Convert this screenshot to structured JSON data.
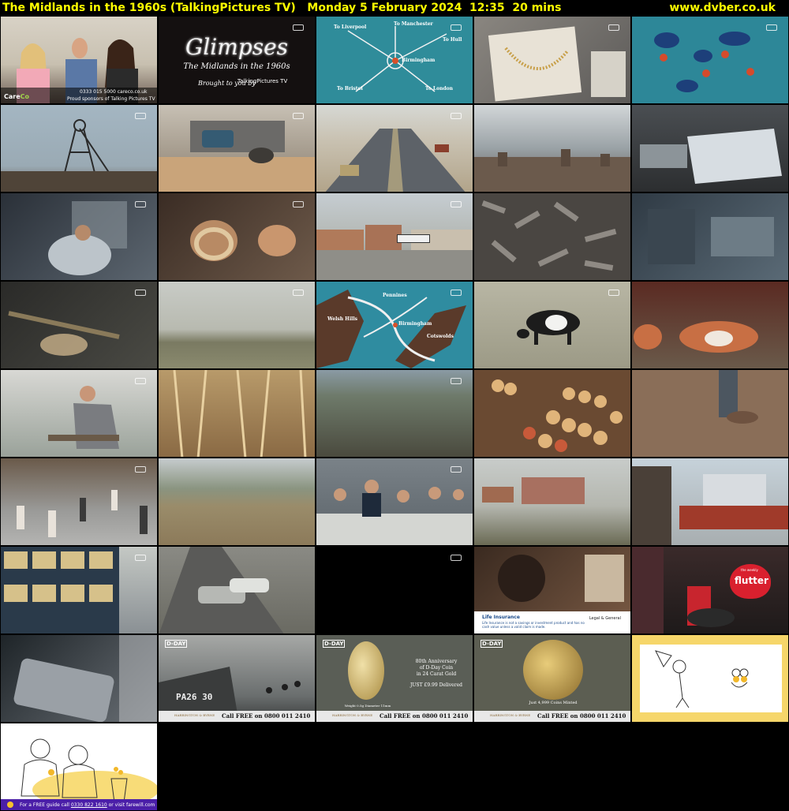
{
  "header": {
    "title": "The Midlands in the 1960s (TalkingPictures TV)   Monday 5 February 2024  12:35  20 mins",
    "site": "www.dvber.co.uk"
  },
  "colors": {
    "header_text": "#ffff00",
    "background": "#000000"
  },
  "tiles": [
    {
      "id": "t01",
      "desc": "careco-advert-couple",
      "texts": {
        "brand_a": "Care",
        "brand_b": "Co",
        "tel": "0333 015 5000   careco.co.uk",
        "sponsor": "Proud sponsors of Talking Pictures TV"
      }
    },
    {
      "id": "t02",
      "desc": "glimpses-title-card",
      "texts": {
        "title": "Glimpses",
        "subtitle": "The Midlands in the 1960s",
        "by": "Brought to you by",
        "channel": "TalkingPictures TV"
      }
    },
    {
      "id": "t03",
      "desc": "road-map-birmingham",
      "texts": {
        "l1": "To Liverpool",
        "l2": "To Manchester",
        "l3": "To Hull",
        "l4": "Birmingham",
        "l5": "To Bristol",
        "l6": "To London"
      }
    },
    {
      "id": "t04",
      "desc": "jewellery-display"
    },
    {
      "id": "t05",
      "desc": "industry-map"
    },
    {
      "id": "t06",
      "desc": "colliery-headframe"
    },
    {
      "id": "t07",
      "desc": "timber-yard-worker"
    },
    {
      "id": "t08",
      "desc": "motorway-traffic"
    },
    {
      "id": "t09",
      "desc": "town-rooftops"
    },
    {
      "id": "t10",
      "desc": "car-factory-line"
    },
    {
      "id": "t11",
      "desc": "workshop-workers"
    },
    {
      "id": "t12",
      "desc": "engraved-ring-closeup"
    },
    {
      "id": "t13",
      "desc": "factory-buildings"
    },
    {
      "id": "t14",
      "desc": "pile-of-bolts"
    },
    {
      "id": "t15",
      "desc": "heavy-machinery"
    },
    {
      "id": "t16",
      "desc": "glass-blowing"
    },
    {
      "id": "t17",
      "desc": "countryside-view"
    },
    {
      "id": "t18",
      "desc": "river-map",
      "texts": {
        "m1": "Pennines",
        "m2": "Birmingham",
        "m3": "Welsh Hills",
        "m4": "Cotswolds"
      }
    },
    {
      "id": "t19",
      "desc": "grazing-cow"
    },
    {
      "id": "t20",
      "desc": "cattle-by-barn"
    },
    {
      "id": "t21",
      "desc": "man-at-bench"
    },
    {
      "id": "t22",
      "desc": "wheat-closeup"
    },
    {
      "id": "t23",
      "desc": "field-workers"
    },
    {
      "id": "t24",
      "desc": "apples-in-baskets"
    },
    {
      "id": "t25",
      "desc": "soil-planting"
    },
    {
      "id": "t26",
      "desc": "street-shoppers"
    },
    {
      "id": "t27",
      "desc": "open-field"
    },
    {
      "id": "t28",
      "desc": "balcony-crowd"
    },
    {
      "id": "t29",
      "desc": "housing-estate"
    },
    {
      "id": "t30",
      "desc": "modern-town-centre"
    },
    {
      "id": "t31",
      "desc": "office-block-windows"
    },
    {
      "id": "t32",
      "desc": "cars-on-road"
    },
    {
      "id": "t33",
      "desc": "black-frame"
    },
    {
      "id": "t34",
      "desc": "life-insurance-advert",
      "texts": {
        "heading": "Life Insurance",
        "body": "Life Insurance is not a savings or investment product and has no cash value unless a valid claim is made.",
        "brand": "Legal & General"
      }
    },
    {
      "id": "t35",
      "desc": "flutter-advert",
      "texts": {
        "brand": "flutter",
        "tag": "the weekly"
      }
    },
    {
      "id": "t36",
      "desc": "suitcase-advert"
    },
    {
      "id": "t37",
      "desc": "dday-landing-craft",
      "texts": {
        "badge": "D-DAY",
        "boat": "PA26 30",
        "company": "HARRINGTON & BYRNE",
        "call": "Call FREE on 0800 011 2410"
      }
    },
    {
      "id": "t38",
      "desc": "dday-coin-silver",
      "texts": {
        "badge": "D-DAY",
        "l1": "80th Anniversary",
        "l2": "of D-Day Coin",
        "l3": "in 24 Carat Gold",
        "l4": "JUST £9.99 Delivered",
        "spec": "Weight 0.5g  Diameter 11mm",
        "company": "HARRINGTON & BYRNE",
        "call": "Call FREE on 0800 011 2410"
      }
    },
    {
      "id": "t39",
      "desc": "dday-coin-gold",
      "texts": {
        "badge": "D-DAY",
        "minted": "Just 4,999 Coins Minted",
        "company": "HARRINGTON & BYRNE",
        "call": "Call FREE on 0800 011 2410"
      }
    },
    {
      "id": "t40",
      "desc": "farewill-cartoon-kite"
    },
    {
      "id": "t41",
      "desc": "farewill-cartoon-couple",
      "texts": {
        "footer_a": "For a FREE guide call",
        "footer_num": "0330 822 1610",
        "footer_b": "or visit farewill.com"
      }
    }
  ]
}
